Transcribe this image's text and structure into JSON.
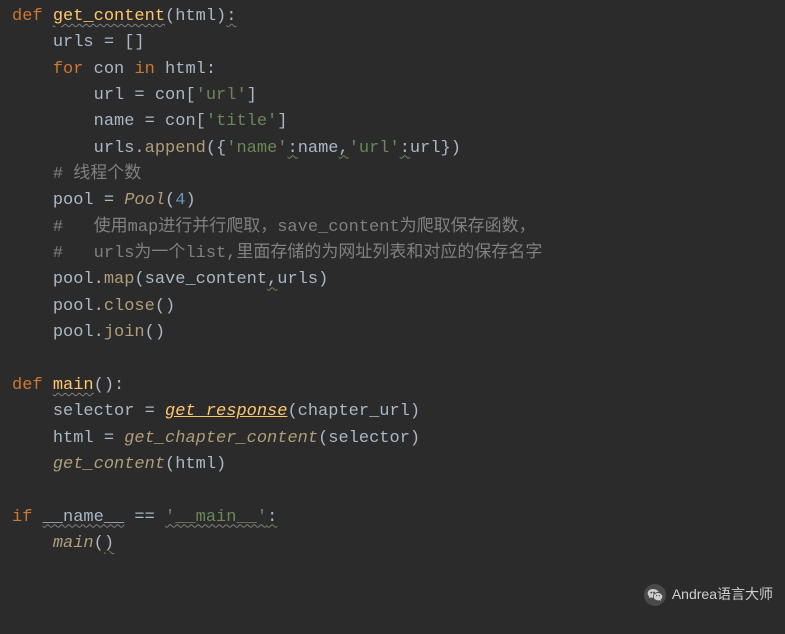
{
  "code": {
    "lines": [
      {
        "idx": 0,
        "tokens": [
          {
            "t": "def ",
            "c": "kw-def"
          },
          {
            "t": "get_content",
            "c": "fn-name wavy-line"
          },
          {
            "t": "(html)",
            "c": "punct"
          },
          {
            "t": ":",
            "c": "wavy-green"
          }
        ]
      },
      {
        "idx": 1,
        "indent": 1,
        "tokens": [
          {
            "t": "urls = []",
            "c": "param"
          }
        ]
      },
      {
        "idx": 2,
        "indent": 1,
        "tokens": [
          {
            "t": "for ",
            "c": "kw-for"
          },
          {
            "t": "con ",
            "c": "param"
          },
          {
            "t": "in ",
            "c": "kw-in"
          },
          {
            "t": "html:",
            "c": "param"
          }
        ]
      },
      {
        "idx": 3,
        "indent": 2,
        "tokens": [
          {
            "t": "url = con[",
            "c": "param"
          },
          {
            "t": "'url'",
            "c": "string"
          },
          {
            "t": "]",
            "c": "param"
          }
        ]
      },
      {
        "idx": 4,
        "indent": 2,
        "tokens": [
          {
            "t": "name = con[",
            "c": "param"
          },
          {
            "t": "'title'",
            "c": "string"
          },
          {
            "t": "]",
            "c": "param"
          }
        ]
      },
      {
        "idx": 5,
        "indent": 2,
        "tokens": [
          {
            "t": "urls.",
            "c": "param"
          },
          {
            "t": "append",
            "c": "self-call"
          },
          {
            "t": "({",
            "c": "param"
          },
          {
            "t": "'name'",
            "c": "string"
          },
          {
            "t": ":",
            "c": "wavy-green"
          },
          {
            "t": "name",
            "c": "param"
          },
          {
            "t": ",",
            "c": "wavy-green"
          },
          {
            "t": "'url'",
            "c": "string"
          },
          {
            "t": ":",
            "c": "wavy-green"
          },
          {
            "t": "url})",
            "c": "param"
          }
        ]
      },
      {
        "idx": 6,
        "indent": 1,
        "tokens": [
          {
            "t": "# 线程个数",
            "c": "comment"
          }
        ]
      },
      {
        "idx": 7,
        "indent": 1,
        "tokens": [
          {
            "t": "pool = ",
            "c": "param"
          },
          {
            "t": "Pool",
            "c": "fn-call"
          },
          {
            "t": "(",
            "c": "param"
          },
          {
            "t": "4",
            "c": "number"
          },
          {
            "t": ")",
            "c": "param"
          }
        ]
      },
      {
        "idx": 8,
        "indent": 1,
        "tokens": [
          {
            "t": "#   使用map进行并行爬取，save_content为爬取保存函数，",
            "c": "comment"
          }
        ]
      },
      {
        "idx": 9,
        "indent": 1,
        "tokens": [
          {
            "t": "#   urls为一个list,里面存储的为网址列表和对应的保存名字",
            "c": "comment"
          }
        ]
      },
      {
        "idx": 10,
        "indent": 1,
        "tokens": [
          {
            "t": "pool.",
            "c": "param"
          },
          {
            "t": "map",
            "c": "self-call"
          },
          {
            "t": "(save_content",
            "c": "param"
          },
          {
            "t": ",",
            "c": "wavy-green"
          },
          {
            "t": "urls)",
            "c": "param"
          }
        ]
      },
      {
        "idx": 11,
        "indent": 1,
        "tokens": [
          {
            "t": "pool.",
            "c": "param"
          },
          {
            "t": "close",
            "c": "self-call"
          },
          {
            "t": "()",
            "c": "param"
          }
        ]
      },
      {
        "idx": 12,
        "indent": 1,
        "tokens": [
          {
            "t": "pool.",
            "c": "param"
          },
          {
            "t": "join",
            "c": "self-call"
          },
          {
            "t": "()",
            "c": "param"
          }
        ]
      },
      {
        "idx": 13,
        "tokens": []
      },
      {
        "idx": 14,
        "tokens": [
          {
            "t": "def ",
            "c": "kw-def"
          },
          {
            "t": "main",
            "c": "fn-name wavy-line"
          },
          {
            "t": "():",
            "c": "punct"
          }
        ]
      },
      {
        "idx": 15,
        "indent": 1,
        "tokens": [
          {
            "t": "selector = ",
            "c": "param"
          },
          {
            "t": "get_response",
            "c": "fn-ref"
          },
          {
            "t": "(chapter_url)",
            "c": "param"
          }
        ]
      },
      {
        "idx": 16,
        "indent": 1,
        "tokens": [
          {
            "t": "html = ",
            "c": "param"
          },
          {
            "t": "get_chapter_content",
            "c": "fn-call"
          },
          {
            "t": "(selector)",
            "c": "param"
          }
        ]
      },
      {
        "idx": 17,
        "indent": 1,
        "tokens": [
          {
            "t": "get_content",
            "c": "fn-call"
          },
          {
            "t": "(html)",
            "c": "param"
          }
        ]
      },
      {
        "idx": 18,
        "tokens": []
      },
      {
        "idx": 19,
        "tokens": [
          {
            "t": "if ",
            "c": "kw-if"
          },
          {
            "t": "__name__",
            "c": "wavy-line"
          },
          {
            "t": " == ",
            "c": "op"
          },
          {
            "t": "'__main__'",
            "c": "string wavy-line"
          },
          {
            "t": ":",
            "c": "wavy-green"
          }
        ]
      },
      {
        "idx": 20,
        "indent": 1,
        "tokens": [
          {
            "t": "main",
            "c": "fn-call"
          },
          {
            "t": "(",
            "c": "param"
          },
          {
            "t": ")",
            "c": "wavy-green"
          }
        ]
      }
    ]
  },
  "watermark": {
    "text": "Andrea语言大师"
  }
}
